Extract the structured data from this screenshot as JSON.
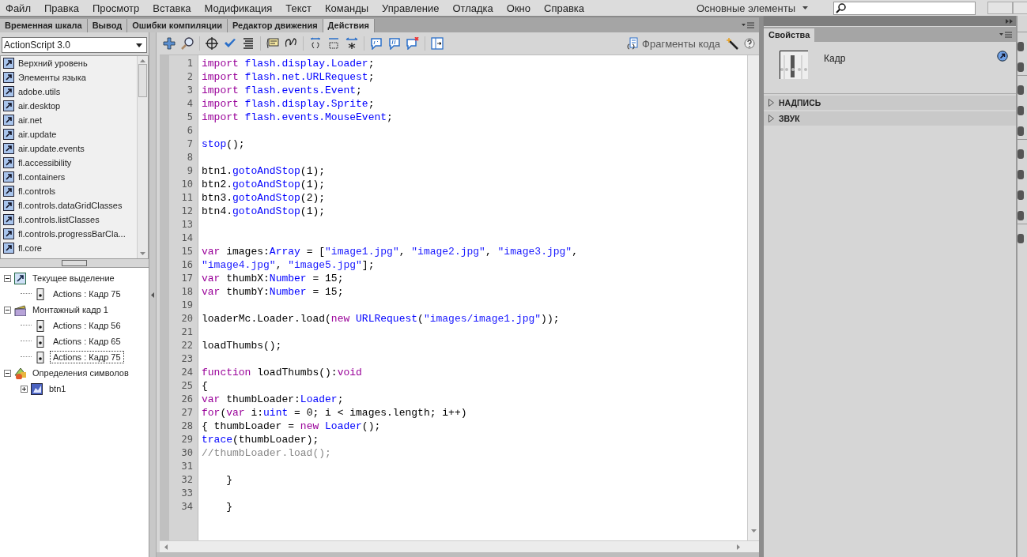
{
  "menu": [
    "Файл",
    "Правка",
    "Просмотр",
    "Вставка",
    "Модификация",
    "Текст",
    "Команды",
    "Управление",
    "Отладка",
    "Окно",
    "Справка"
  ],
  "workspace": "Основные элементы",
  "panel_tabs": [
    {
      "label": "Временная шкала",
      "selected": false
    },
    {
      "label": "Вывод",
      "selected": false
    },
    {
      "label": "Ошибки компиляции",
      "selected": false
    },
    {
      "label": "Редактор движения",
      "selected": false
    },
    {
      "label": "Действия",
      "selected": true
    }
  ],
  "language": "ActionScript 3.0",
  "packages": [
    "Верхний уровень",
    "Элементы языка",
    "adobe.utils",
    "air.desktop",
    "air.net",
    "air.update",
    "air.update.events",
    "fl.accessibility",
    "fl.containers",
    "fl.controls",
    "fl.controls.dataGridClasses",
    "fl.controls.listClasses",
    "fl.controls.progressBarCla...",
    "fl.core"
  ],
  "script_tree": [
    {
      "label": "Текущее выделение",
      "kind": "selection",
      "expanded": true,
      "selected": false,
      "children": [
        {
          "label": "Actions : Кадр 75",
          "kind": "frame",
          "selected": false
        }
      ]
    },
    {
      "label": "Монтажный кадр 1",
      "kind": "scene",
      "expanded": true,
      "selected": false,
      "children": [
        {
          "label": "Actions : Кадр 56",
          "kind": "frame",
          "selected": false
        },
        {
          "label": "Actions : Кадр 65",
          "kind": "frame",
          "selected": false
        },
        {
          "label": "Actions : Кадр 75",
          "kind": "frame",
          "selected": true
        }
      ]
    },
    {
      "label": "Определения символов",
      "kind": "symbols",
      "expanded": true,
      "selected": false,
      "children": [
        {
          "label": "btn1",
          "kind": "symbol",
          "expanded": false,
          "selected": false
        }
      ]
    }
  ],
  "code_snippets": "Фрагменты кода",
  "code": [
    {
      "number": "1",
      "tokens": [
        {
          "kind": "keyword",
          "text": "import "
        },
        {
          "kind": "identifier",
          "text": "flash.display.Loader"
        },
        {
          "kind": "plain",
          "text": ";"
        }
      ]
    },
    {
      "number": "2",
      "tokens": [
        {
          "kind": "keyword",
          "text": "import "
        },
        {
          "kind": "identifier",
          "text": "flash.net.URLRequest"
        },
        {
          "kind": "plain",
          "text": ";"
        }
      ]
    },
    {
      "number": "3",
      "tokens": [
        {
          "kind": "keyword",
          "text": "import "
        },
        {
          "kind": "identifier",
          "text": "flash.events.Event"
        },
        {
          "kind": "plain",
          "text": ";"
        }
      ]
    },
    {
      "number": "4",
      "tokens": [
        {
          "kind": "keyword",
          "text": "import "
        },
        {
          "kind": "identifier",
          "text": "flash.display.Sprite"
        },
        {
          "kind": "plain",
          "text": ";"
        }
      ]
    },
    {
      "number": "5",
      "tokens": [
        {
          "kind": "keyword",
          "text": "import "
        },
        {
          "kind": "identifier",
          "text": "flash.events.MouseEvent"
        },
        {
          "kind": "plain",
          "text": ";"
        }
      ]
    },
    {
      "number": "6"
    },
    {
      "number": "7",
      "tokens": [
        {
          "kind": "identifier",
          "text": "stop"
        },
        {
          "kind": "plain",
          "text": "();"
        }
      ]
    },
    {
      "number": "8"
    },
    {
      "number": "9",
      "tokens": [
        {
          "kind": "plain",
          "text": "btn1."
        },
        {
          "kind": "identifier",
          "text": "gotoAndStop"
        },
        {
          "kind": "plain",
          "text": "(1);"
        }
      ]
    },
    {
      "number": "10",
      "tokens": [
        {
          "kind": "plain",
          "text": "btn2."
        },
        {
          "kind": "identifier",
          "text": "gotoAndStop"
        },
        {
          "kind": "plain",
          "text": "(1);"
        }
      ]
    },
    {
      "number": "11",
      "tokens": [
        {
          "kind": "plain",
          "text": "btn3."
        },
        {
          "kind": "identifier",
          "text": "gotoAndStop"
        },
        {
          "kind": "plain",
          "text": "(2);"
        }
      ]
    },
    {
      "number": "12",
      "tokens": [
        {
          "kind": "plain",
          "text": "btn4."
        },
        {
          "kind": "identifier",
          "text": "gotoAndStop"
        },
        {
          "kind": "plain",
          "text": "(1);"
        }
      ]
    },
    {
      "number": "13"
    },
    {
      "number": "14"
    },
    {
      "number": "15",
      "tokens": [
        {
          "kind": "keyword",
          "text": "var"
        },
        {
          "kind": "plain",
          "text": " images:"
        },
        {
          "kind": "identifier",
          "text": "Array"
        },
        {
          "kind": "plain",
          "text": " = ["
        },
        {
          "kind": "string",
          "text": "\"image1.jpg\""
        },
        {
          "kind": "plain",
          "text": ", "
        },
        {
          "kind": "string",
          "text": "\"image2.jpg\""
        },
        {
          "kind": "plain",
          "text": ", "
        },
        {
          "kind": "string",
          "text": "\"image3.jpg\""
        },
        {
          "kind": "plain",
          "text": ","
        }
      ]
    },
    {
      "number": "16",
      "tokens": [
        {
          "kind": "string",
          "text": "\"image4.jpg\""
        },
        {
          "kind": "plain",
          "text": ", "
        },
        {
          "kind": "string",
          "text": "\"image5.jpg\""
        },
        {
          "kind": "plain",
          "text": "];"
        }
      ]
    },
    {
      "number": "17",
      "tokens": [
        {
          "kind": "keyword",
          "text": "var"
        },
        {
          "kind": "plain",
          "text": " thumbX:"
        },
        {
          "kind": "identifier",
          "text": "Number"
        },
        {
          "kind": "plain",
          "text": " = 15;"
        }
      ]
    },
    {
      "number": "18",
      "tokens": [
        {
          "kind": "keyword",
          "text": "var"
        },
        {
          "kind": "plain",
          "text": " thumbY:"
        },
        {
          "kind": "identifier",
          "text": "Number"
        },
        {
          "kind": "plain",
          "text": " = 15;"
        }
      ]
    },
    {
      "number": "19"
    },
    {
      "number": "20",
      "tokens": [
        {
          "kind": "plain",
          "text": "loaderMc.Loader.load("
        },
        {
          "kind": "keyword",
          "text": "new "
        },
        {
          "kind": "identifier",
          "text": "URLRequest"
        },
        {
          "kind": "plain",
          "text": "("
        },
        {
          "kind": "string",
          "text": "\"images/image1.jpg\""
        },
        {
          "kind": "plain",
          "text": "));"
        }
      ]
    },
    {
      "number": "21"
    },
    {
      "number": "22",
      "tokens": [
        {
          "kind": "plain",
          "text": "loadThumbs();"
        }
      ]
    },
    {
      "number": "23"
    },
    {
      "number": "24",
      "tokens": [
        {
          "kind": "keyword",
          "text": "function"
        },
        {
          "kind": "plain",
          "text": " loadThumbs():"
        },
        {
          "kind": "keyword",
          "text": "void"
        }
      ]
    },
    {
      "number": "25",
      "tokens": [
        {
          "kind": "plain",
          "text": "{"
        }
      ]
    },
    {
      "number": "26",
      "tokens": [
        {
          "kind": "keyword",
          "text": "var"
        },
        {
          "kind": "plain",
          "text": " thumbLoader:"
        },
        {
          "kind": "identifier",
          "text": "Loader"
        },
        {
          "kind": "plain",
          "text": ";"
        }
      ]
    },
    {
      "number": "27",
      "tokens": [
        {
          "kind": "keyword",
          "text": "for"
        },
        {
          "kind": "plain",
          "text": "("
        },
        {
          "kind": "keyword",
          "text": "var"
        },
        {
          "kind": "plain",
          "text": " i:"
        },
        {
          "kind": "identifier",
          "text": "uint"
        },
        {
          "kind": "plain",
          "text": " = 0; i < images.length; i++)"
        }
      ]
    },
    {
      "number": "28",
      "tokens": [
        {
          "kind": "plain",
          "text": "{ thumbLoader = "
        },
        {
          "kind": "keyword",
          "text": "new "
        },
        {
          "kind": "identifier",
          "text": "Loader"
        },
        {
          "kind": "plain",
          "text": "();"
        }
      ]
    },
    {
      "number": "29",
      "tokens": [
        {
          "kind": "identifier",
          "text": "trace"
        },
        {
          "kind": "plain",
          "text": "(thumbLoader);"
        }
      ]
    },
    {
      "number": "30",
      "tokens": [
        {
          "kind": "comment",
          "text": "//thumbLoader.load();"
        }
      ]
    },
    {
      "number": "31"
    },
    {
      "number": "32",
      "tokens": [
        {
          "kind": "plain",
          "text": "    }"
        }
      ]
    },
    {
      "number": "33"
    },
    {
      "number": "34",
      "tokens": [
        {
          "kind": "plain",
          "text": "    }"
        }
      ]
    }
  ],
  "properties": {
    "tab": "Свойства",
    "type": "Кадр",
    "sections": [
      {
        "label": "НАДПИСЬ",
        "expanded": false
      },
      {
        "label": "ЗВУК",
        "expanded": false
      }
    ]
  }
}
